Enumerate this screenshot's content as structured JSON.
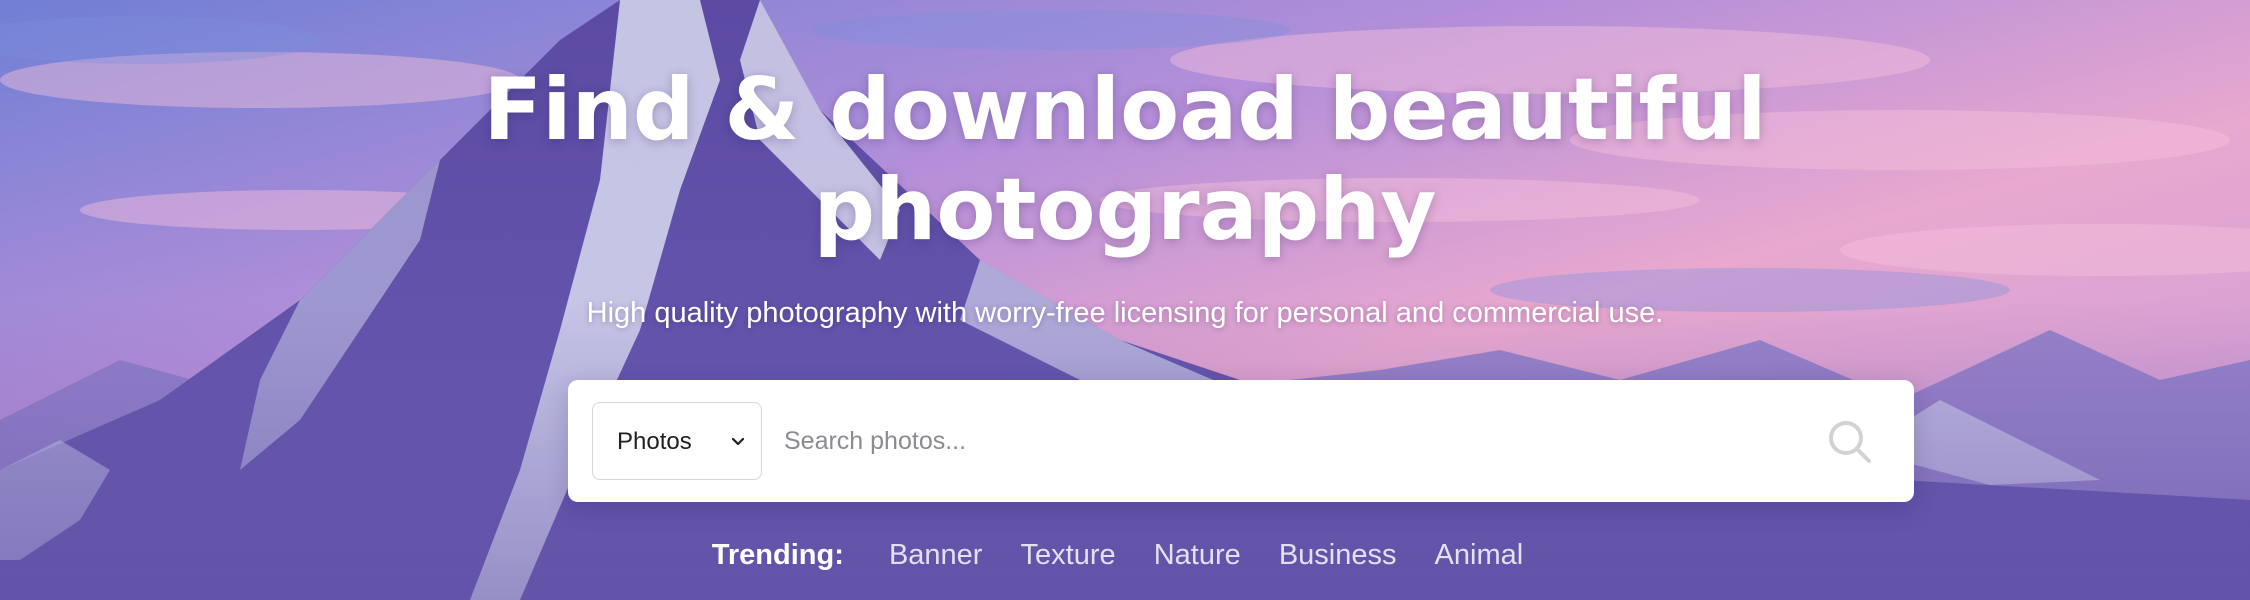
{
  "hero": {
    "headline_line1": "Find & download beautiful",
    "headline_line2": "photography",
    "subtitle": "High quality photography with worry-free licensing for personal and commercial use."
  },
  "search": {
    "type_label": "Photos",
    "placeholder": "Search photos...",
    "value": ""
  },
  "trending": {
    "label": "Trending:",
    "tags": [
      "Banner",
      "Texture",
      "Nature",
      "Business",
      "Animal"
    ]
  },
  "icons": {
    "dropdown": "chevron-down-icon",
    "search": "search-icon"
  },
  "colors": {
    "headline_text": "#ffffff",
    "search_box_bg": "#ffffff",
    "sky_pink": "#e7a6d1",
    "sky_purple": "#8b78d8",
    "mountain_shadow": "#4d3e95"
  }
}
